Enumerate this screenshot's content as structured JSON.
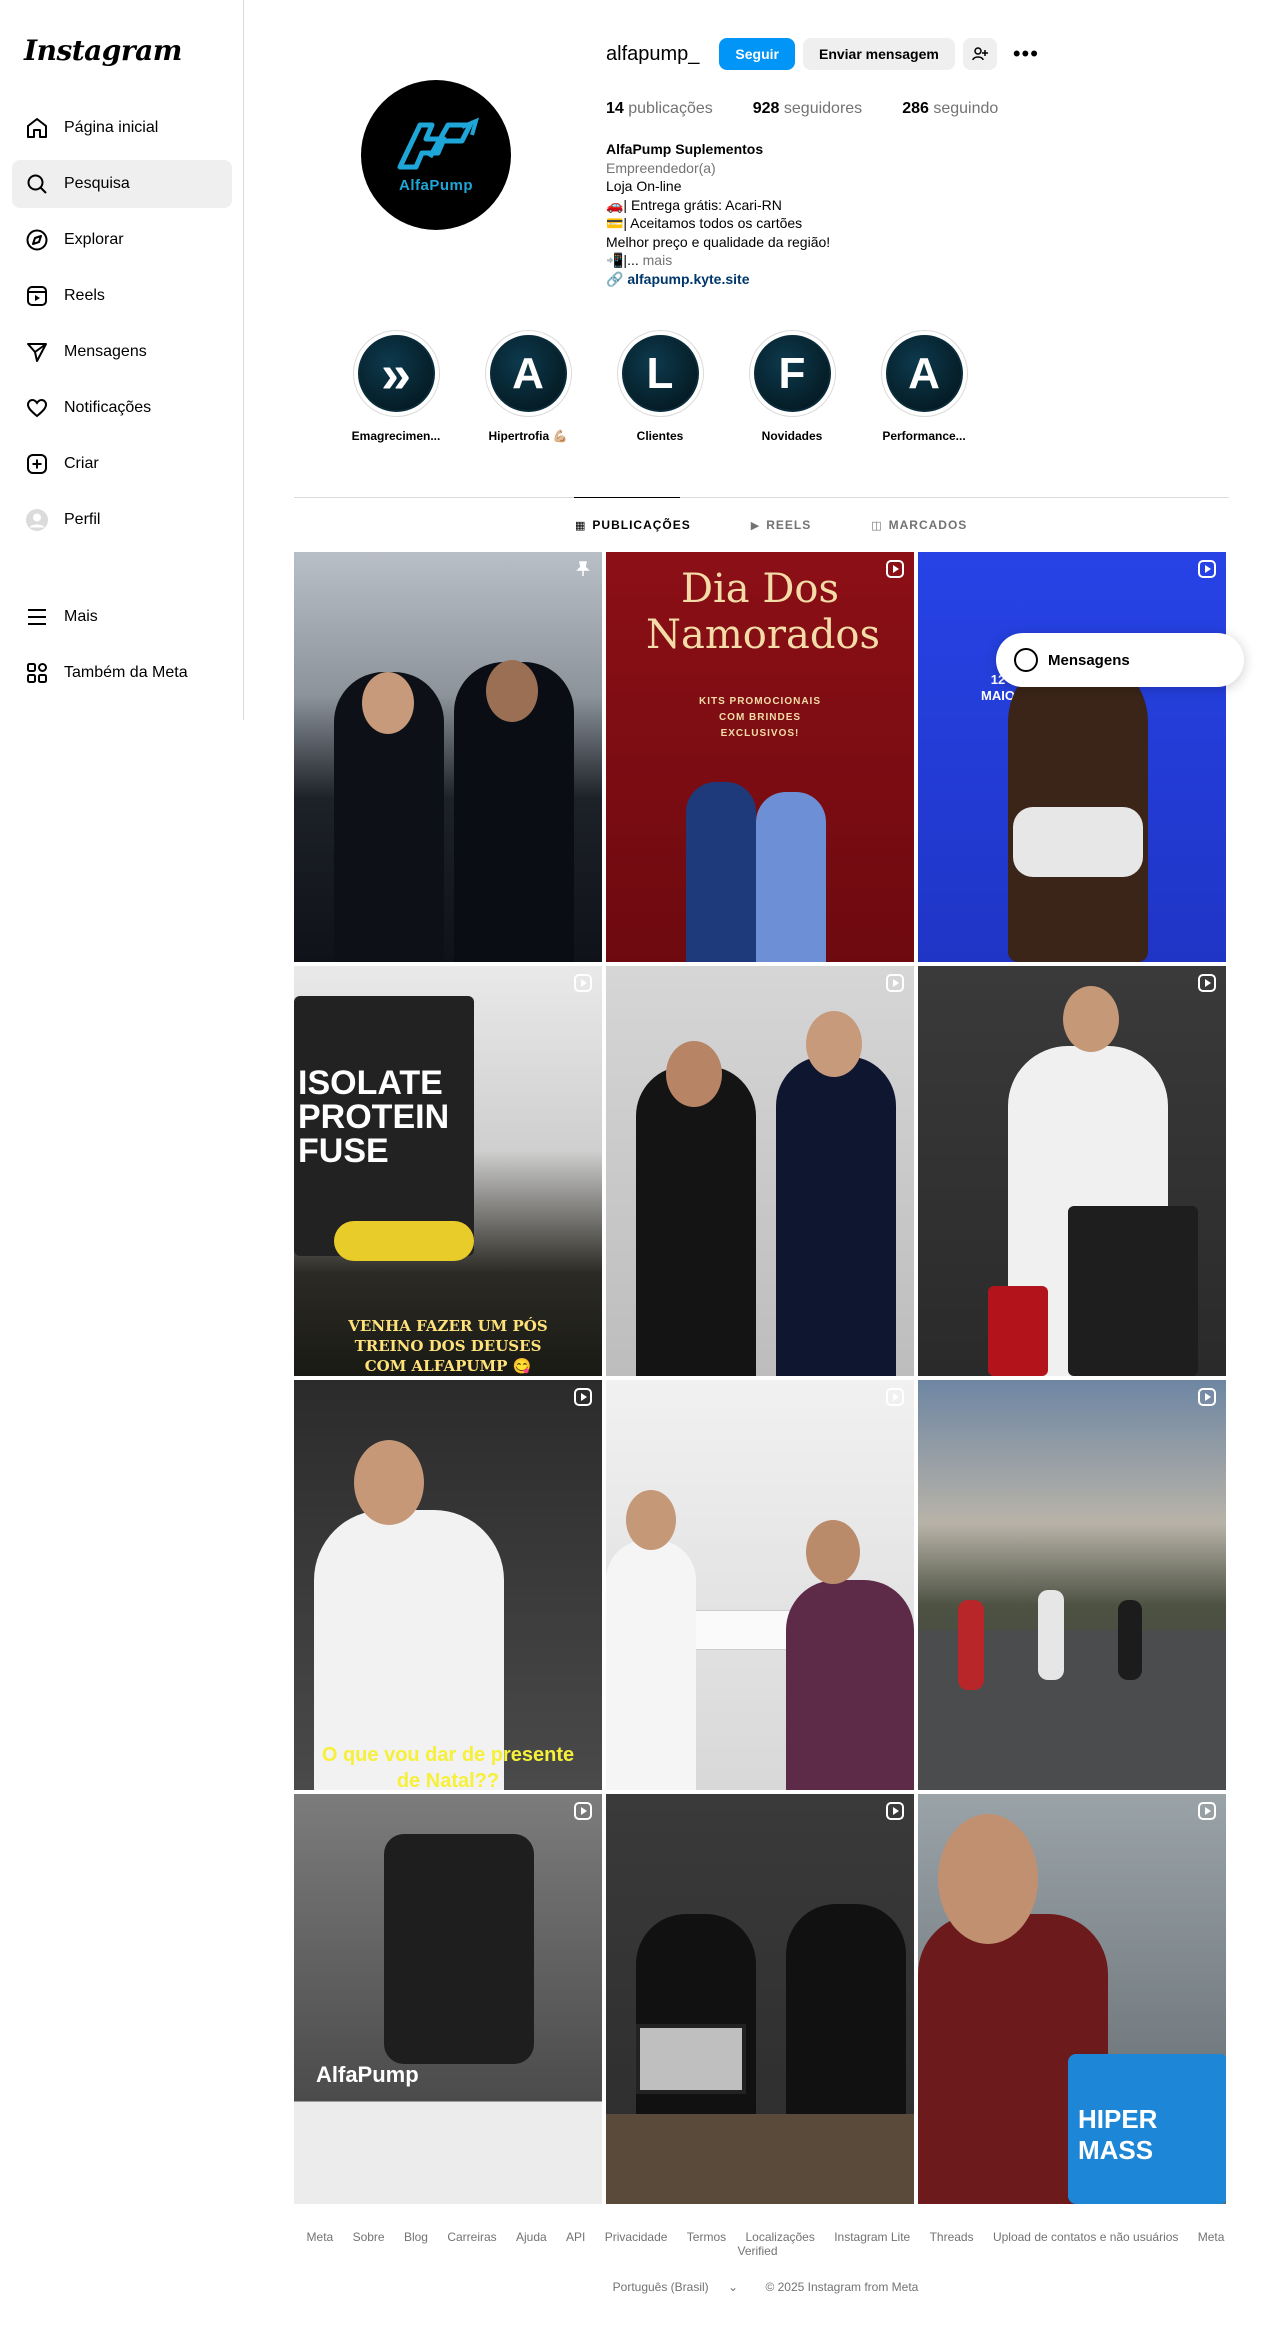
{
  "sidebar": {
    "logo": "Instagram",
    "items": [
      {
        "label": "Página inicial",
        "icon": "home-icon"
      },
      {
        "label": "Pesquisa",
        "icon": "search-icon"
      },
      {
        "label": "Explorar",
        "icon": "compass-icon"
      },
      {
        "label": "Reels",
        "icon": "reels-icon"
      },
      {
        "label": "Mensagens",
        "icon": "send-icon"
      },
      {
        "label": "Notificações",
        "icon": "heart-icon"
      },
      {
        "label": "Criar",
        "icon": "plus-square-icon"
      },
      {
        "label": "Perfil",
        "icon": "avatar-icon"
      }
    ],
    "lower": [
      {
        "label": "Mais",
        "icon": "menu-icon"
      },
      {
        "label": "Também da Meta",
        "icon": "meta-apps-icon"
      }
    ]
  },
  "profile": {
    "username": "alfapump_",
    "follow_label": "Seguir",
    "message_label": "Enviar mensagem",
    "avatar_brand": "AlfaPump",
    "stats": {
      "posts_count": "14",
      "posts_label": "publicações",
      "followers_count": "928",
      "followers_label": "seguidores",
      "following_count": "286",
      "following_label": "seguindo"
    },
    "bio": {
      "name": "AlfaPump Suplementos",
      "category": "Empreendedor(a)",
      "line1": "Loja On-line",
      "line2": "🚗| Entrega grátis: Acari-RN",
      "line3": "💳| Aceitamos todos os cartões",
      "line4": "Melhor preço e qualidade da região!",
      "line5": "📲|...",
      "more": "mais",
      "link": "alfapump.kyte.site"
    }
  },
  "highlights": [
    {
      "label": "Emagrecimen...",
      "glyph": "»"
    },
    {
      "label": "Hipertrofia 💪🏼",
      "glyph": "A"
    },
    {
      "label": "Clientes",
      "glyph": "L"
    },
    {
      "label": "Novidades",
      "glyph": "F"
    },
    {
      "label": "Performance...",
      "glyph": "A"
    }
  ],
  "tabs": [
    {
      "label": "PUBLICAÇÕES",
      "icon": "▦"
    },
    {
      "label": "REELS",
      "icon": "▶"
    },
    {
      "label": "MARCADOS",
      "icon": "◫"
    }
  ],
  "posts": {
    "p2_title": "Dia Dos Namorados",
    "p2_sub": "KITS PROMOCIONAIS COM BRINDES EXCLUSIVOS!",
    "p3_date": "12 MAIO",
    "p4_caption": "VENHA FAZER UM PÓS TREINO DOS DEUSES COM ALFAPUMP 😋",
    "p4_product": "ISOLATE PROTEIN FUSE",
    "p7_caption": "O que vou dar de presente de Natal??",
    "p10_logo": "AlfaPump",
    "p12_product": "HIPER MASS"
  },
  "messages_bubble": "Mensagens",
  "footer": {
    "links": [
      "Meta",
      "Sobre",
      "Blog",
      "Carreiras",
      "Ajuda",
      "API",
      "Privacidade",
      "Termos",
      "Localizações",
      "Instagram Lite",
      "Threads",
      "Upload de contatos e não usuários",
      "Meta Verified"
    ],
    "language": "Português (Brasil)",
    "copyright": "© 2025 Instagram from Meta"
  },
  "colors": {
    "accent": "#0095f6",
    "brand": "#1fa6d8",
    "text_muted": "#737373"
  }
}
